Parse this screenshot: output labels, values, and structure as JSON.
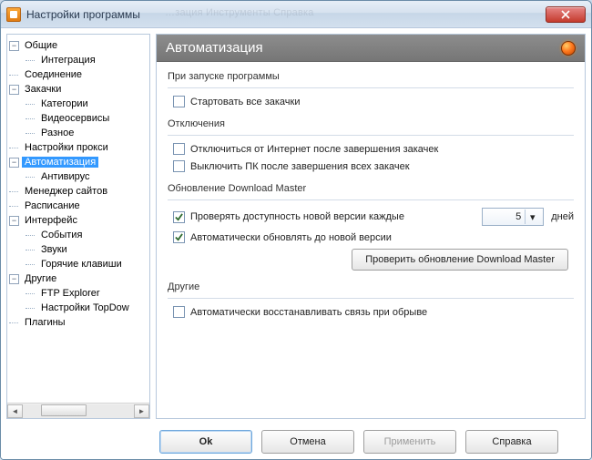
{
  "window": {
    "title": "Настройки программы"
  },
  "ghost_menu": "…зация    Инструменты    Справка",
  "tree": {
    "n0": "Общие",
    "n0_0": "Интеграция",
    "n1": "Соединение",
    "n2": "Закачки",
    "n2_0": "Категории",
    "n2_1": "Видеосервисы",
    "n2_2": "Разное",
    "n3": "Настройки прокси",
    "n4": "Автоматизация",
    "n4_0": "Антивирус",
    "n5": "Менеджер сайтов",
    "n6": "Расписание",
    "n7": "Интерфейс",
    "n7_0": "События",
    "n7_1": "Звуки",
    "n7_2": "Горячие клавиши",
    "n8": "Другие",
    "n8_0": "FTP Explorer",
    "n8_1": "Настройки TopDow",
    "n9": "Плагины"
  },
  "page": {
    "title": "Автоматизация",
    "g1_title": "При запуске программы",
    "g1_c1": "Стартовать все закачки",
    "g2_title": "Отключения",
    "g2_c1": "Отключиться от Интернет после завершения закачек",
    "g2_c2": "Выключить ПК после завершения всех закачек",
    "g3_title": "Обновление Download Master",
    "g3_c1": "Проверять доступность новой версии каждые",
    "g3_days": "дней",
    "g3_combo": "5",
    "g3_c2": "Автоматически обновлять до новой версии",
    "g3_btn": "Проверить обновление Download Master",
    "g4_title": "Другие",
    "g4_c1": "Автоматически восстанавливать связь при обрыве"
  },
  "buttons": {
    "ok": "Ok",
    "cancel": "Отмена",
    "apply": "Применить",
    "help": "Справка"
  }
}
